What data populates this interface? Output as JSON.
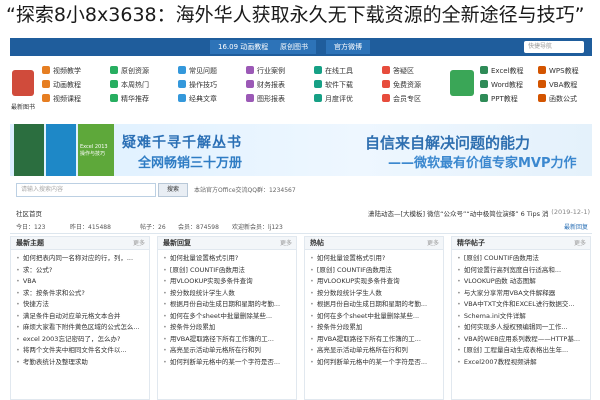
{
  "overlay_title": "“探索8小8x3638：海外华人获取永久无下载资源的全新途径与技巧”",
  "topbar": {
    "tabs": [
      "原创图书",
      "原创图书",
      "官方微博",
      "16.09 动画教程"
    ],
    "search_placeholder": "快捷导航"
  },
  "iconnav": {
    "groups": [
      {
        "links": [
          "视频教学",
          "动画教程",
          "视频课程"
        ]
      },
      {
        "links": [
          "原创资源",
          "本周热门",
          "精华推荐"
        ]
      },
      {
        "links": [
          "常见问题",
          "操作技巧",
          "经典文章"
        ]
      },
      {
        "links": [
          "行业案例",
          "财务报表",
          "图形报表"
        ]
      },
      {
        "links": [
          "在线工具",
          "软件下载",
          "月度评优"
        ]
      },
      {
        "links": [
          "答疑区",
          "免费资源",
          "会员专区"
        ]
      },
      {
        "links": [
          "Excel教程",
          "Word教程",
          "PPT教程"
        ]
      },
      {
        "links": [
          "WPS教程",
          "VBA教程",
          "函数公式"
        ]
      }
    ],
    "book_caption": "最新图书"
  },
  "banner": {
    "slogan_left_1": "疑难千寻千解丛书",
    "slogan_left_2": "全网畅销三十万册",
    "slogan_right_1": "自信来自解决问题的能力",
    "slogan_right_2": "——微软最有价值专家MVP力作",
    "book_text": "Excel 2013 操作与技巧"
  },
  "search": {
    "placeholder": "请输入搜索内容",
    "button": "搜索",
    "note": "本站官方Office交流QQ群：1234567"
  },
  "breadcrumb": {
    "home": "社区首页",
    "notice": "潇陆动态—[大模板] 微信“公众号”“动中极简位演绎” 6 Tips 消费券",
    "date": "(2019-12-1)"
  },
  "stats": {
    "today": "今日：123",
    "yesterday": "昨日：415488",
    "posts": "帖子：26",
    "members": "会员：874598",
    "newest": "欢迎新会员：lj123",
    "more": "最新回复"
  },
  "columns": [
    {
      "title": "最新主题",
      "more": "更多",
      "items": [
        "如何把表内同一名称对应的行，列，...",
        "求：公式?",
        "VBA",
        "求：按条件求和公式?",
        "快捷方法",
        "满足条件自动对应单元格文本合并",
        "麻烦大家看下附件黄色区域的公式怎么...",
        "excel 2003忘记密码了，怎么办?",
        "将两个文件夹中相同文件名文件以...",
        "考勤表统计及整理求助"
      ]
    },
    {
      "title": "最新回复",
      "more": "更多",
      "items": [
        "如何批量设置格式引用?",
        "[原创] COUNTIF函数用法",
        "用VLOOKUP实现多条件查询",
        "按分数段统计学生人数",
        "根据月份自动生成日期和星期的考勤...",
        "如何在多个sheet中批量删除某些...",
        "按条件分段累加",
        "用VBA提取路径下所有工作簿的工...",
        "高亮显示活动单元格所在行和列",
        "如何判断单元格中的某一个字符是否..."
      ]
    },
    {
      "title": "热帖",
      "more": "更多",
      "items": [
        "如何批量设置格式引用?",
        "[原创] COUNTIF函数用法",
        "用VLOOKUP实现多条件查询",
        "按分数段统计学生人数",
        "根据月份自动生成日期和星期的考勤...",
        "如何在多个sheet中批量删除某些...",
        "按条件分段累加",
        "用VBA提取路径下所有工作簿的工...",
        "高亮显示活动单元格所在行和列",
        "如何判断单元格中的某一个字符是否..."
      ]
    },
    {
      "title": "精华帖子",
      "more": "更多",
      "items": [
        "[原创] COUNTIF函数用法",
        "如何设置行高列宽度自行适高和...",
        "VLOOKUP函数 动态图解",
        "与大家分享常用VBA文件解释器",
        "VBA中TXT文件和EXCEL进行数据交...",
        "Schema.ini文件详解",
        "如何实现多人授权预编辑同一工作...",
        "VBA的WEB应用系列教程——HTTP基...",
        "[原创] 工程量自动生成表格出生年...",
        "Excel2007教程视频讲解"
      ]
    }
  ],
  "colors": {
    "topbar": "#1f5d9c",
    "accent": "#2a6fb5"
  }
}
